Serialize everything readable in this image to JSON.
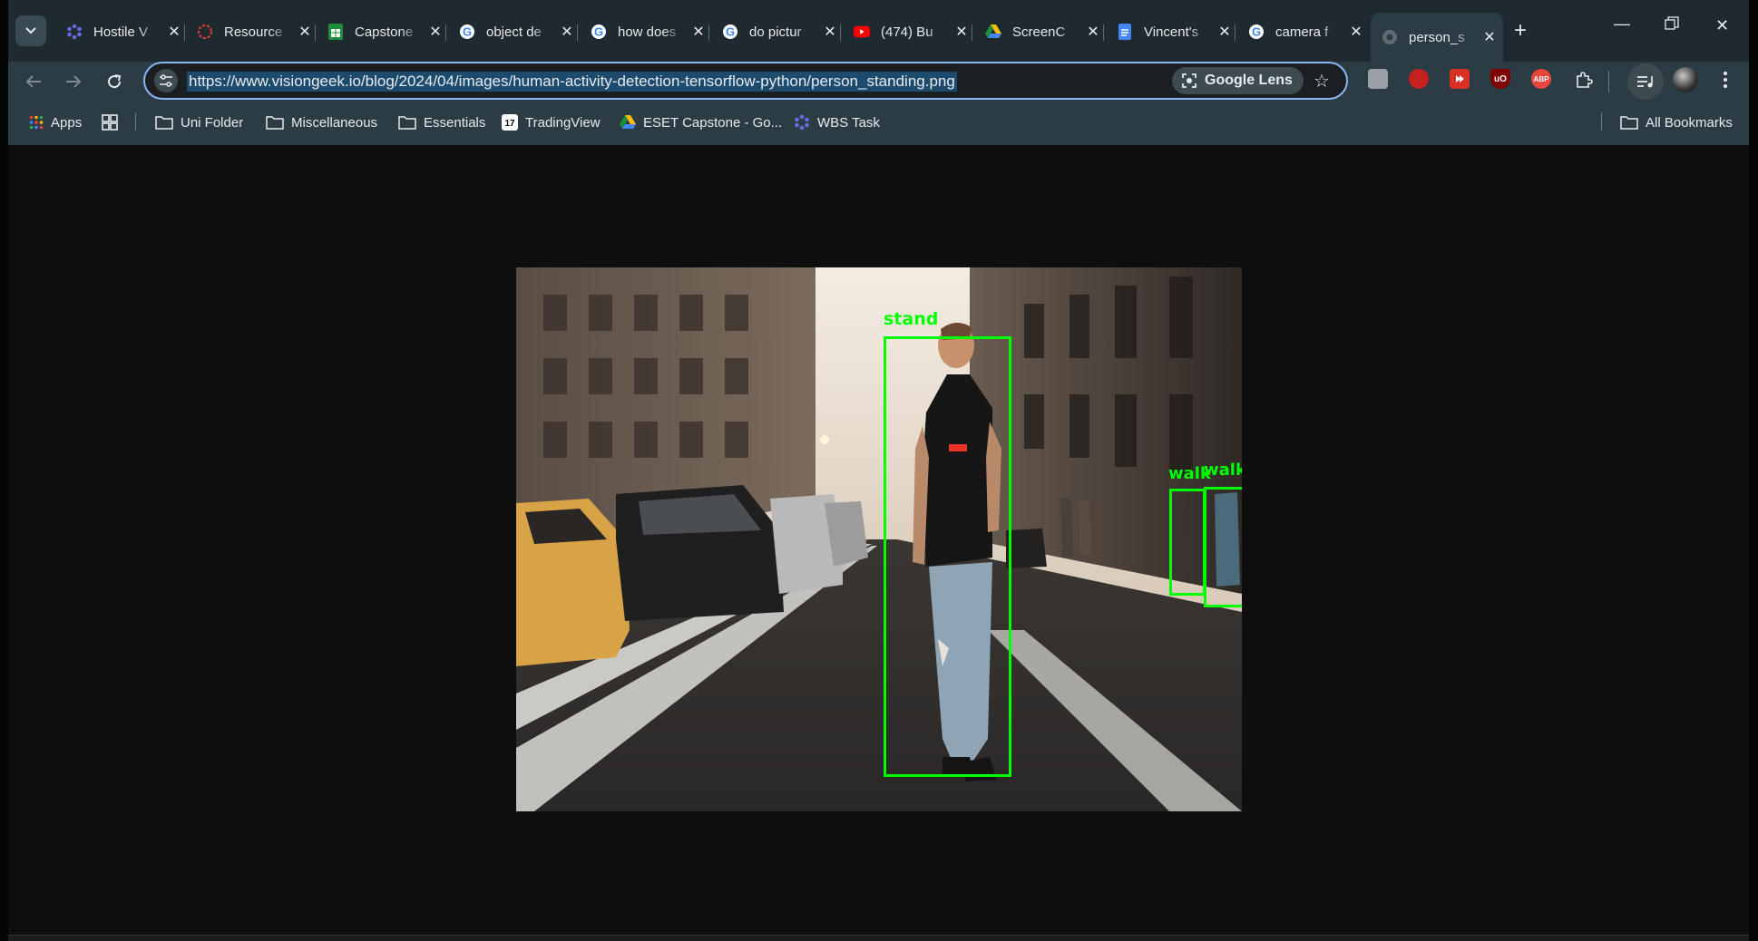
{
  "tabs": [
    {
      "title": "Hostile V",
      "icon": "asterisk-icon",
      "color": "#5b5bd6"
    },
    {
      "title": "Resource",
      "icon": "canvas-icon",
      "color": "#e03c31"
    },
    {
      "title": "Capstone",
      "icon": "sheets-icon",
      "color": "#1e8e3e"
    },
    {
      "title": "object de",
      "icon": "google-icon",
      "color": "#4285f4"
    },
    {
      "title": "how does",
      "icon": "google-icon",
      "color": "#4285f4"
    },
    {
      "title": "do pictur",
      "icon": "google-icon",
      "color": "#4285f4"
    },
    {
      "title": "(474) Bu",
      "icon": "youtube-icon",
      "color": "#ff0000"
    },
    {
      "title": "ScreenC",
      "icon": "drive-icon",
      "color": "#fbbc04"
    },
    {
      "title": "Vincent's",
      "icon": "docs-icon",
      "color": "#4285f4"
    },
    {
      "title": "camera f",
      "icon": "google-icon",
      "color": "#4285f4"
    },
    {
      "title": "person_s",
      "icon": "globe-icon",
      "color": "#7a8288",
      "active": true
    }
  ],
  "address_bar": {
    "url": "https://www.visiongeek.io/blog/2024/04/images/human-activity-detection-tensorflow-python/person_standing.png",
    "lens_label": "Google Lens"
  },
  "extensions": [
    {
      "name": "hand-extension-icon",
      "color": "#9aa0a6",
      "label": ""
    },
    {
      "name": "red-circle-extension-icon",
      "color": "#c5221f",
      "label": ""
    },
    {
      "name": "red-play-extension-icon",
      "color": "#d93025",
      "label": ""
    },
    {
      "name": "ublock-extension-icon",
      "color": "#800000",
      "label": "uO"
    },
    {
      "name": "adblock-plus-extension-icon",
      "color": "#e8453c",
      "label": "ABP"
    }
  ],
  "bookmarks": {
    "apps_label": "Apps",
    "items": [
      {
        "label": "Uni Folder",
        "icon": "folder-icon"
      },
      {
        "label": "Miscellaneous",
        "icon": "folder-icon"
      },
      {
        "label": "Essentials",
        "icon": "folder-icon"
      },
      {
        "label": "TradingView",
        "icon": "tradingview-icon"
      },
      {
        "label": "ESET Capstone - Go...",
        "icon": "drive-icon"
      },
      {
        "label": "WBS Task",
        "icon": "asterisk-icon"
      }
    ],
    "all_bookmarks_label": "All Bookmarks"
  },
  "detections": [
    {
      "label": "stand"
    },
    {
      "label": "walk"
    },
    {
      "label": "walk"
    }
  ],
  "colors": {
    "detection_box": "#00ff00",
    "url_highlight": "#1d4b6e",
    "omnibox_border": "#8ab4f8"
  }
}
